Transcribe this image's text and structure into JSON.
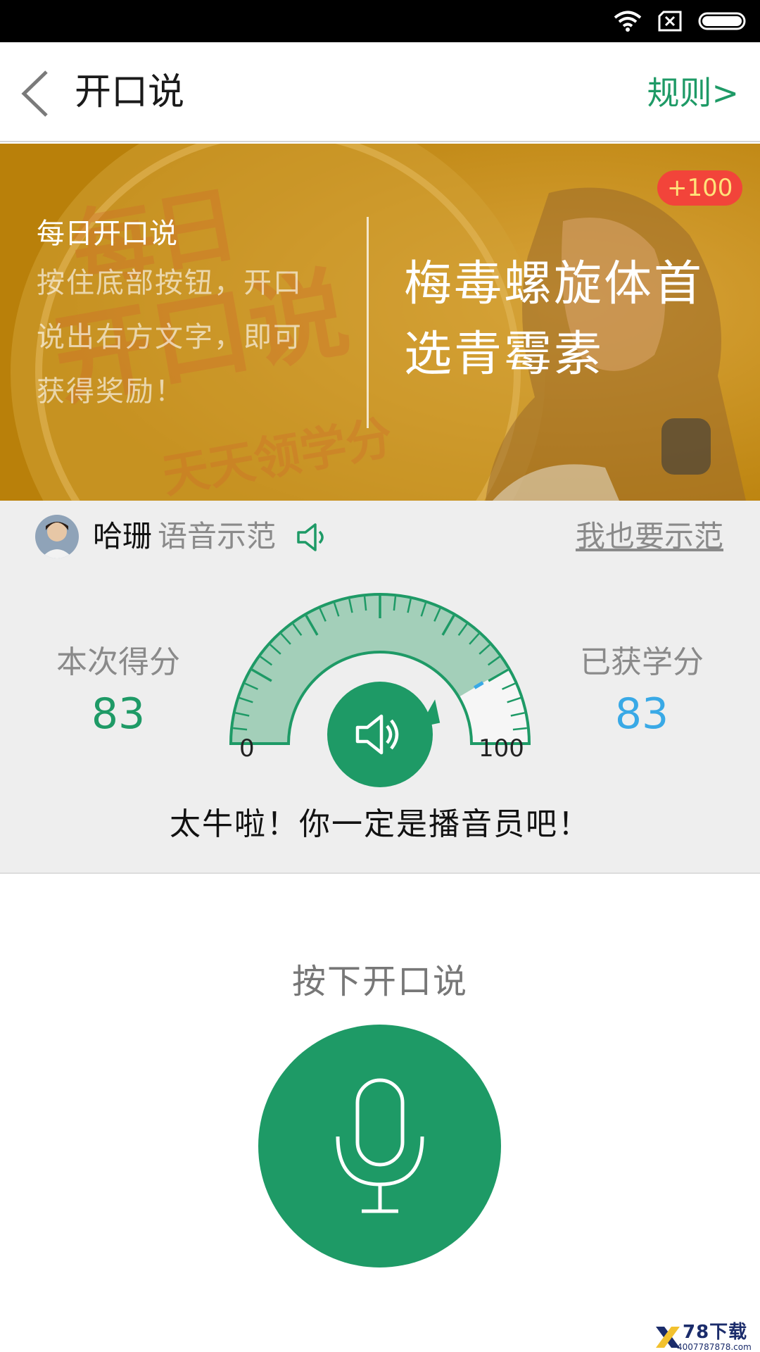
{
  "status_bar": {
    "icons": [
      "wifi-icon",
      "sim-card-off-icon",
      "battery-icon"
    ]
  },
  "header": {
    "back_icon": "chevron-left-icon",
    "title": "开口说",
    "rules_link": "规则>"
  },
  "banner": {
    "background_logo_text": [
      "每日",
      "开口说",
      "天天领学分"
    ],
    "reward_badge": "+100",
    "heading": "每日开口说",
    "description_lines": [
      "按住底部按钮，开口",
      "说出右方文字，即可",
      "获得奖励！"
    ],
    "phrase_lines": [
      "梅毒螺旋体首",
      "选青霉素"
    ]
  },
  "demo": {
    "user_name": "哈珊",
    "label": "语音示范",
    "speaker_icon": "speaker-icon",
    "link": "我也要示范"
  },
  "score": {
    "current_caption": "本次得分",
    "current_value": "83",
    "earned_caption": "已获学分",
    "earned_value": "83",
    "gauge_min": "0",
    "gauge_max": "100",
    "gauge_level": 83,
    "play_icon": "speaker-icon",
    "feedback": "太牛啦！你一定是播音员吧！"
  },
  "record": {
    "hint": "按下开口说",
    "mic_icon": "microphone-icon"
  },
  "watermark": {
    "title": "78下载",
    "phone": "4007787878.com"
  },
  "colors": {
    "brand_green": "#1e9a66",
    "score_blue": "#39a9e6",
    "badge_red": "#f2443a",
    "banner_gold": "#c78e12"
  }
}
